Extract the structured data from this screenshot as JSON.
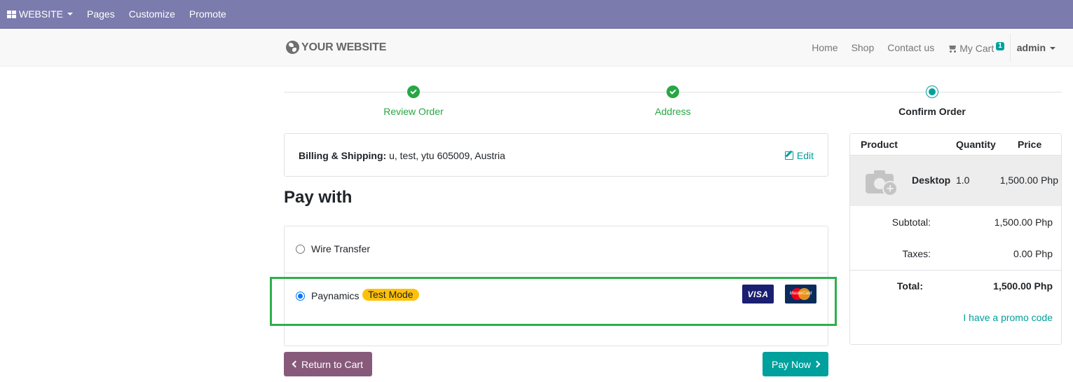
{
  "admin_bar": {
    "website_label": "WEBSITE",
    "pages_label": "Pages",
    "customize_label": "Customize",
    "promote_label": "Promote"
  },
  "navbar": {
    "logo_text": "YOUR WEBSITE",
    "links": [
      "Home",
      "Shop",
      "Contact us"
    ],
    "cart_label": "My Cart",
    "cart_count": "1",
    "user_label": "admin"
  },
  "steps": [
    {
      "label": "Review Order",
      "state": "done"
    },
    {
      "label": "Address",
      "state": "done"
    },
    {
      "label": "Confirm Order",
      "state": "current"
    }
  ],
  "billing": {
    "label": "Billing & Shipping:",
    "value": "u, test, ytu 605009, Austria",
    "edit_label": "Edit"
  },
  "pay_with_title": "Pay with",
  "payment_methods": [
    {
      "label": "Wire Transfer",
      "selected": false
    },
    {
      "label": "Paynamics",
      "selected": true,
      "badge": "Test Mode",
      "cards": [
        "VISA",
        "MasterCard"
      ]
    }
  ],
  "buttons": {
    "return_label": "Return to Cart",
    "pay_label": "Pay Now"
  },
  "summary": {
    "headers": {
      "product": "Product",
      "quantity": "Quantity",
      "price": "Price"
    },
    "item": {
      "name": "Desktop",
      "quantity": "1.0",
      "price": "1,500.00 Php"
    },
    "subtotal_label": "Subtotal:",
    "subtotal_value": "1,500.00 Php",
    "taxes_label": "Taxes:",
    "taxes_value": "0.00 Php",
    "total_label": "Total:",
    "total_value": "1,500.00 Php",
    "promo_label": "I have a promo code"
  },
  "colors": {
    "admin_bar": "#7c7bad",
    "primary": "#00a09d",
    "secondary": "#875a7b",
    "success": "#28a745",
    "warning": "#ffc107",
    "highlight_box": "#2db04b"
  }
}
